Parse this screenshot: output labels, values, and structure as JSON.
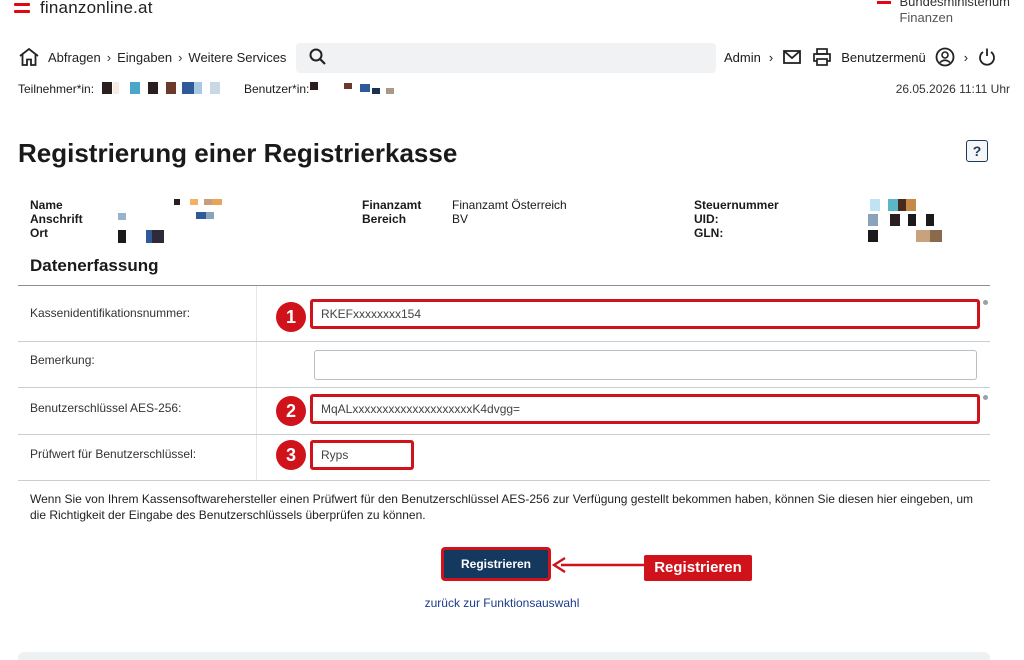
{
  "header": {
    "brand": "finanzonline.at",
    "ministry_line1": "Bundesministerium",
    "ministry_line2": "Finanzen"
  },
  "nav": {
    "breadcrumbs": [
      "Abfragen",
      "Eingaben",
      "Weitere Services"
    ],
    "search_placeholder": "",
    "admin": "Admin",
    "user_menu": "Benutzermenü"
  },
  "session": {
    "participant_label": "Teilnehmer*in:",
    "user_label": "Benutzer*in:",
    "datetime": "26.05.2026 11:11 Uhr"
  },
  "page": {
    "title": "Registrierung einer Registrierkasse",
    "help": "?"
  },
  "taxpayer": {
    "name_label": "Name",
    "address_label": "Anschrift",
    "city_label": "Ort",
    "office_label": "Finanzamt",
    "office_value": "Finanzamt Österreich",
    "area_label": "Bereich",
    "area_value": "BV",
    "taxno_label": "Steuernummer",
    "uid_label": "UID:",
    "gln_label": "GLN:"
  },
  "form": {
    "section_title": "Datenerfassung",
    "fields": [
      {
        "label": "Kassenidentifikationsnummer:",
        "value": "RKEFxxxxxxxx154",
        "badge": "1"
      },
      {
        "label": "Bemerkung:",
        "value": ""
      },
      {
        "label": "Benutzerschlüssel AES-256:",
        "value": "MqALxxxxxxxxxxxxxxxxxxxxK4dvgg=",
        "badge": "2"
      },
      {
        "label": "Prüfwert für Benutzerschlüssel:",
        "value": "Ryps",
        "badge": "3"
      }
    ],
    "hint": "Wenn Sie von Ihrem Kassensoftwarehersteller einen Prüfwert für den Benutzerschlüssel AES-256 zur Verfügung gestellt bekommen haben, können Sie diesen hier eingeben, um die Richtigkeit der Eingabe des Benutzerschlüssels überprüfen zu können.",
    "submit": "Registrieren",
    "callout": "Registrieren",
    "back": "zurück zur Funktionsauswahl"
  },
  "colors": {
    "accent_red": "#d0121b",
    "button_navy": "#15395e",
    "link_blue": "#1b3a8c"
  },
  "icons": [
    "home-icon",
    "search-icon",
    "mail-icon",
    "print-icon",
    "user-icon",
    "power-icon",
    "chevron-right-icon",
    "arrow-left-icon"
  ]
}
